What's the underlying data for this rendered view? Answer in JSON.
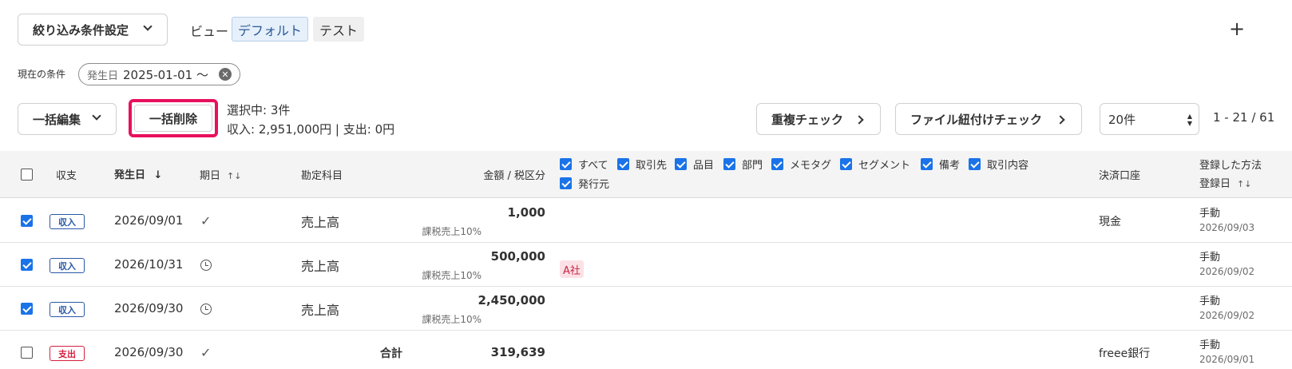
{
  "top": {
    "filter_button": "絞り込み条件設定",
    "view_label": "ビュー",
    "views": [
      "デフォルト",
      "テスト"
    ],
    "add_view": "+"
  },
  "condition": {
    "label": "現在の条件",
    "chip_key": "発生日",
    "chip_value": "2025-01-01 〜"
  },
  "actions": {
    "bulk_edit": "一括編集",
    "bulk_delete": "一括削除",
    "selected": "選択中: 3件",
    "summary": "収入: 2,951,000円 | 支出: 0円",
    "dup_check": "重複チェック",
    "file_check": "ファイル紐付けチェック",
    "per_page": "20件",
    "page_range": "1 - 21 / 61"
  },
  "header": {
    "type": "収支",
    "date": "発生日",
    "term": "期日",
    "account": "勘定科目",
    "amount": "金額 / 税区分",
    "column_options": [
      "すべて",
      "取引先",
      "品目",
      "部門",
      "メモタグ",
      "セグメント",
      "備考",
      "取引内容",
      "発行元"
    ],
    "wallet": "決済口座",
    "reg_method": "登録した方法",
    "reg_date": "登録日"
  },
  "rows": [
    {
      "checked": true,
      "type": "収入",
      "date": "2026/09/01",
      "term": "done",
      "account": "売上高",
      "amount": "1,000",
      "tax": "課税売上10%",
      "partner": "",
      "wallet": "現金",
      "method": "手動",
      "reg_date": "2026/09/03"
    },
    {
      "checked": true,
      "type": "収入",
      "date": "2026/10/31",
      "term": "pending",
      "account": "売上高",
      "amount": "500,000",
      "tax": "課税売上10%",
      "partner": "A社",
      "wallet": "",
      "method": "手動",
      "reg_date": "2026/09/02"
    },
    {
      "checked": true,
      "type": "収入",
      "date": "2026/09/30",
      "term": "pending",
      "account": "売上高",
      "amount": "2,450,000",
      "tax": "課税売上10%",
      "partner": "",
      "wallet": "",
      "method": "手動",
      "reg_date": "2026/09/02"
    },
    {
      "checked": false,
      "type": "支出",
      "date": "2026/09/30",
      "term": "done",
      "account": "",
      "total_label": "合計",
      "amount": "319,639",
      "tax": "",
      "partner": "",
      "wallet": "freee銀行",
      "method": "手動",
      "reg_date": "2026/09/01"
    }
  ],
  "colors": {
    "accent": "#1a73e8",
    "highlight": "#e8105c",
    "income": "#2a58a8",
    "expense": "#d6203f"
  }
}
